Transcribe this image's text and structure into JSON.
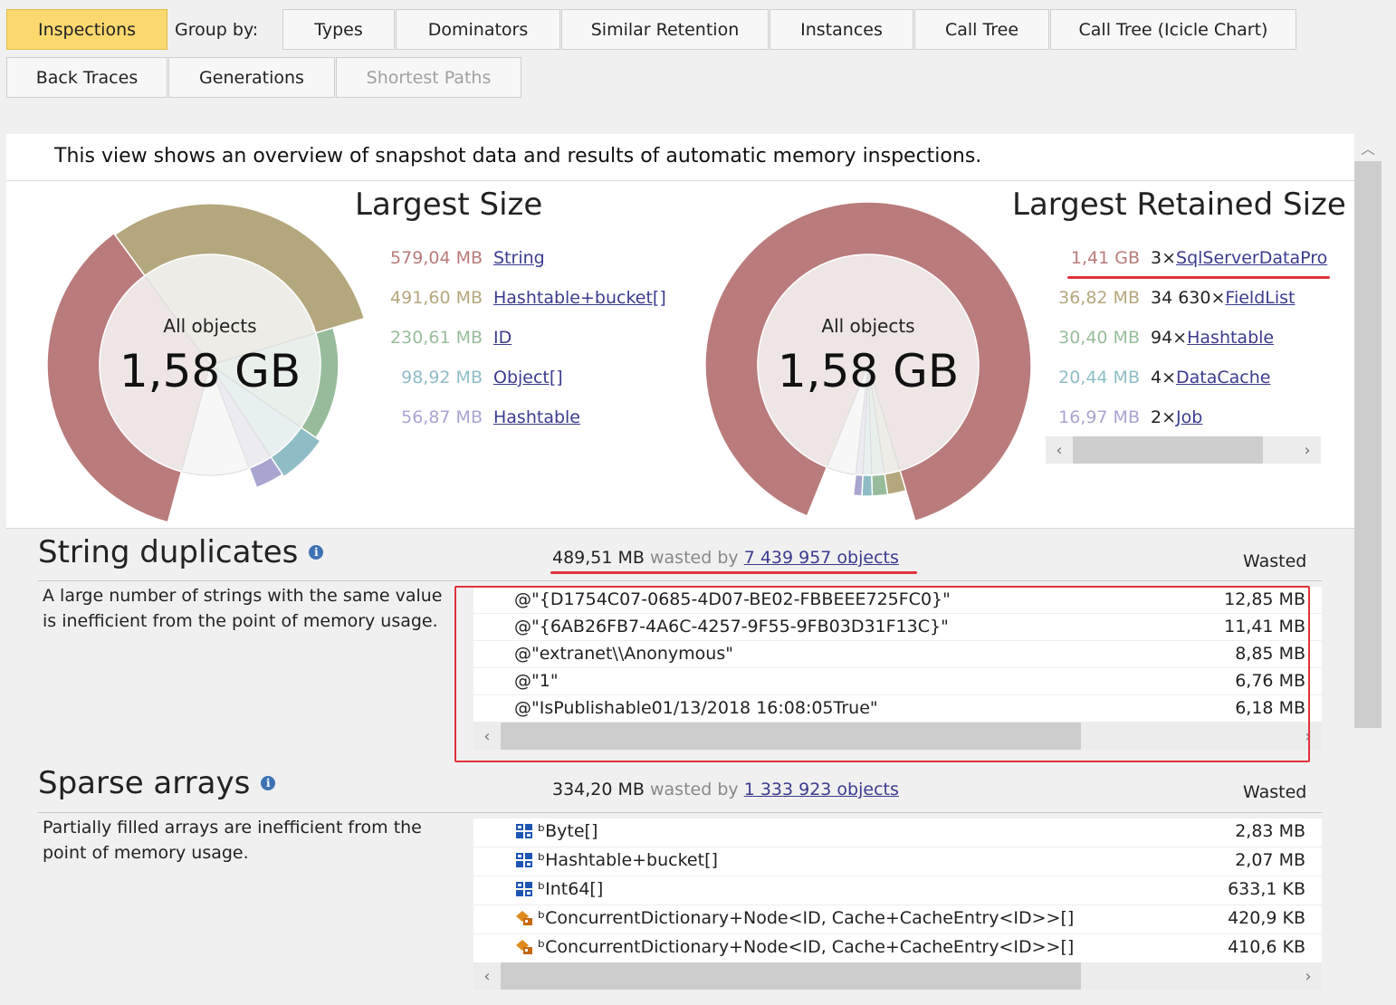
{
  "tabs": {
    "inspections": "Inspections",
    "group_by": "Group by:",
    "types": "Types",
    "dominators": "Dominators",
    "similar_retention": "Similar Retention",
    "instances": "Instances",
    "call_tree": "Call Tree",
    "call_tree_icicle": "Call Tree (Icicle Chart)",
    "back_traces": "Back Traces",
    "generations": "Generations",
    "shortest_paths": "Shortest Paths"
  },
  "intro": "This view shows an overview of snapshot data and results of automatic memory inspections.",
  "largest_size": {
    "title": "Largest Size",
    "center_label": "All objects",
    "center_value": "1,58 GB",
    "items": [
      {
        "size": "579,04 MB",
        "type": "String",
        "color": "#b97b7b"
      },
      {
        "size": "491,60 MB",
        "type": "Hashtable+bucket[]",
        "color": "#b4a77e"
      },
      {
        "size": "230,61 MB",
        "type": "ID",
        "color": "#98bc9b"
      },
      {
        "size": "98,92 MB",
        "type": "Object[]",
        "color": "#8fbdc5"
      },
      {
        "size": "56,87 MB",
        "type": "Hashtable",
        "color": "#a8a5d1"
      }
    ]
  },
  "largest_retained": {
    "title": "Largest Retained Size",
    "center_label": "All objects",
    "center_value": "1,58 GB",
    "items": [
      {
        "size": "1,41 GB",
        "count": "3×",
        "type": "SqlServerDataPro",
        "color": "#b97b7b"
      },
      {
        "size": "36,82 MB",
        "count": "34 630×",
        "type": "FieldList",
        "color": "#b4a77e"
      },
      {
        "size": "30,40 MB",
        "count": "94×",
        "type": "Hashtable",
        "color": "#98bc9b"
      },
      {
        "size": "20,44 MB",
        "count": "4×",
        "type": "DataCache",
        "color": "#8fbdc5"
      },
      {
        "size": "16,97 MB",
        "count": "2×",
        "type": "Job",
        "color": "#a8a5d1"
      }
    ]
  },
  "string_duplicates": {
    "title": "String duplicates",
    "description": "A large number of strings with the same value is inefficient from the point of memory usage.",
    "wasted_amount": "489,51 MB",
    "wasted_by": "wasted by",
    "objects_link": "7 439 957 objects",
    "wasted_header": "Wasted",
    "rows": [
      {
        "value": "@\"{D1754C07-0685-4D07-BE02-FBBEEE725FC0}\"",
        "wasted": "12,85 MB"
      },
      {
        "value": "@\"{6AB26FB7-4A6C-4257-9F55-9FB03D31F13C}\"",
        "wasted": "11,41 MB"
      },
      {
        "value": "@\"extranet\\\\Anonymous\"",
        "wasted": "8,85 MB"
      },
      {
        "value": "@\"1\"",
        "wasted": "6,76 MB"
      },
      {
        "value": "@\"IsPublishable01/13/2018 16:08:05True\"",
        "wasted": "6,18 MB"
      }
    ]
  },
  "sparse_arrays": {
    "title": "Sparse arrays",
    "description": "Partially filled arrays are inefficient from the point of memory usage.",
    "wasted_amount": "334,20 MB",
    "wasted_by": "wasted by",
    "objects_link": "1 333 923 objects",
    "wasted_header": "Wasted",
    "rows": [
      {
        "icon": "array-icon",
        "value": "ᵇByte[]",
        "wasted": "2,83 MB"
      },
      {
        "icon": "array-icon",
        "value": "ᵇHashtable+bucket[]",
        "wasted": "2,07 MB"
      },
      {
        "icon": "array-icon",
        "value": "ᵇInt64[]",
        "wasted": "633,1 KB"
      },
      {
        "icon": "generic-class-icon",
        "value": "ᵇConcurrentDictionary+Node<ID, Cache+CacheEntry<ID>>[]",
        "wasted": "420,9 KB"
      },
      {
        "icon": "generic-class-icon",
        "value": "ᵇConcurrentDictionary+Node<ID, Cache+CacheEntry<ID>>[]",
        "wasted": "410,6 KB"
      }
    ]
  },
  "colors": {
    "active_tab": "#fbd96f",
    "highlight_red": "#e0323a",
    "link": "#3b3b8f"
  }
}
